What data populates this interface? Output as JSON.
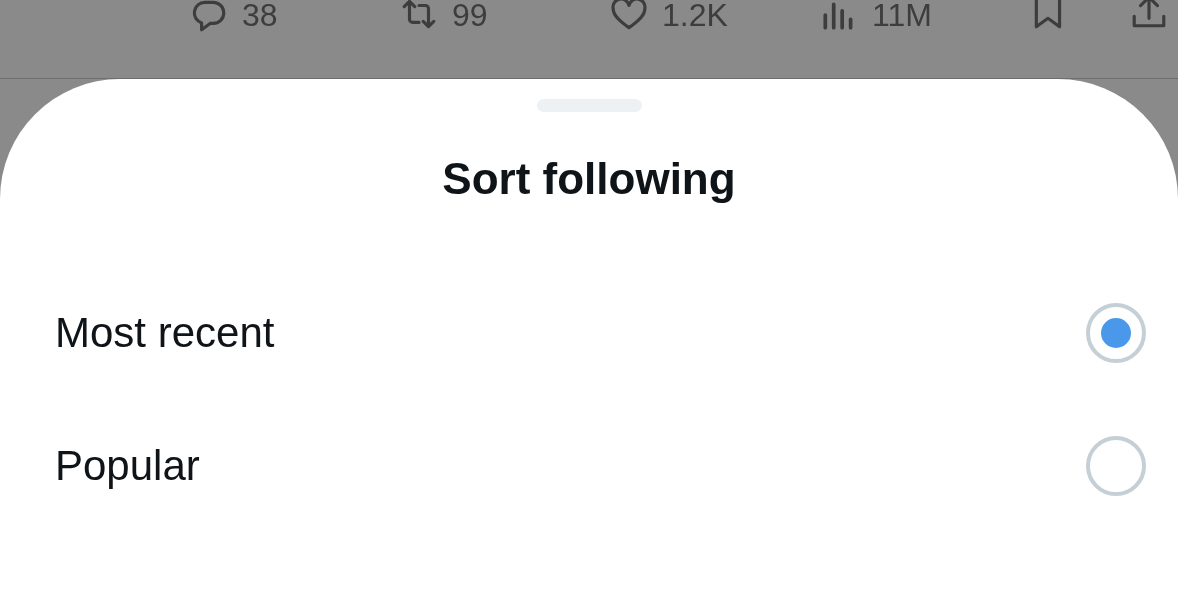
{
  "actions": [
    {
      "kind": "reply",
      "count": "38"
    },
    {
      "kind": "repost",
      "count": "99"
    },
    {
      "kind": "like",
      "count": "1.2K"
    },
    {
      "kind": "views",
      "count": "11M"
    },
    {
      "kind": "bookmark"
    },
    {
      "kind": "share"
    }
  ],
  "sheet": {
    "title": "Sort following",
    "options": [
      {
        "label": "Most recent",
        "selected": true
      },
      {
        "label": "Popular",
        "selected": false
      }
    ]
  }
}
